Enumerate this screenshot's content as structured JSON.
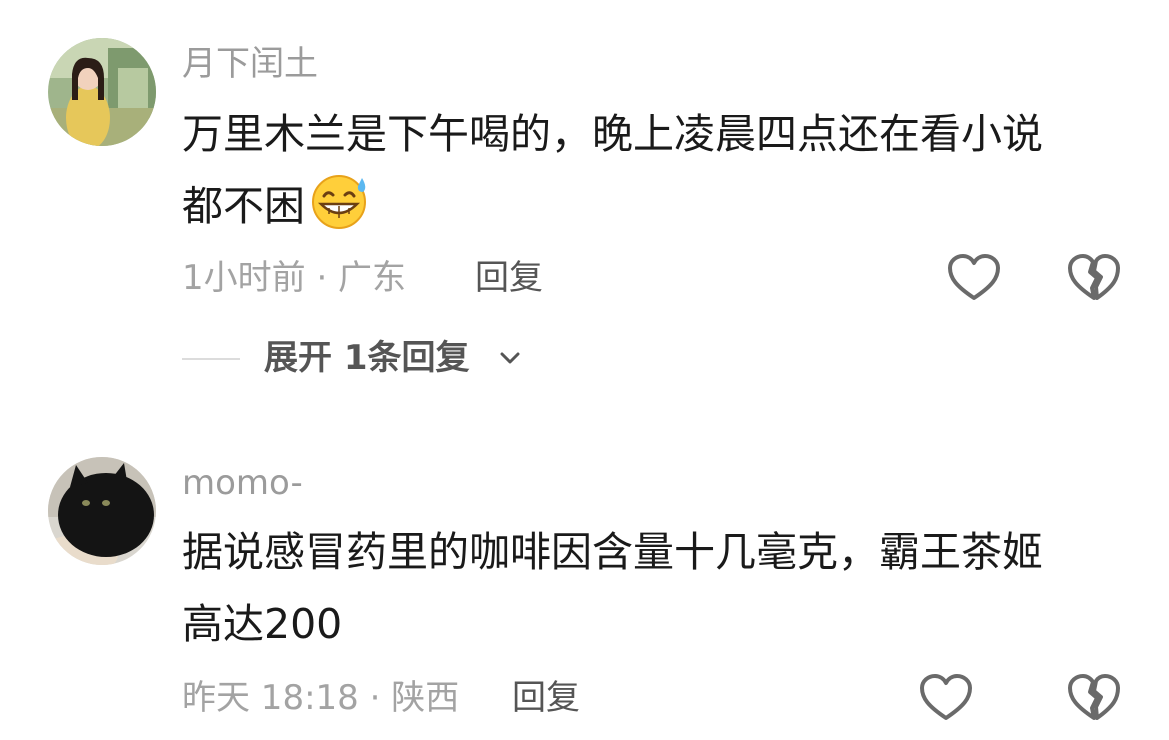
{
  "comments": [
    {
      "username": "月下闰土",
      "lines": [
        "万里木兰是下午喝的，晚上凌晨四点还在看小说",
        "都不困"
      ],
      "emoji": "grinning-sweat-emoji",
      "meta": "1小时前 · 广东",
      "reply_label": "回复",
      "like_icon": "heart-outline-icon",
      "dislike_icon": "broken-heart-icon",
      "expand_label": "展开 1条回复"
    },
    {
      "username": "momo-",
      "lines": [
        "据说感冒药里的咖啡因含量十几毫克，霸王茶姬",
        "高达200"
      ],
      "meta": "昨天 18:18 · 陕西",
      "reply_label": "回复",
      "like_icon": "heart-outline-icon",
      "dislike_icon": "broken-heart-icon"
    }
  ],
  "colors": {
    "username": "#9b9b9b",
    "meta": "#a3a3a3",
    "action": "#555555",
    "body": "#1a1a1a"
  }
}
